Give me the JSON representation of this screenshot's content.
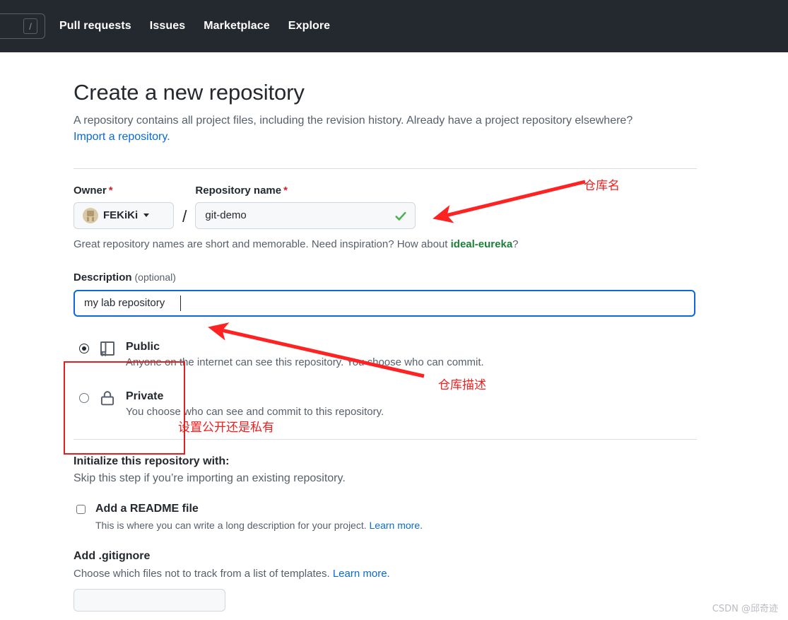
{
  "topnav": {
    "search_shortcut": "/",
    "links": [
      {
        "label": "Pull requests"
      },
      {
        "label": "Issues"
      },
      {
        "label": "Marketplace"
      },
      {
        "label": "Explore"
      }
    ]
  },
  "page": {
    "title": "Create a new repository",
    "subtitle": "A repository contains all project files, including the revision history. Already have a project repository elsewhere?",
    "import_link": "Import a repository."
  },
  "form": {
    "owner_label": "Owner",
    "owner_required": "*",
    "owner_value": "FEKiKi",
    "separator": "/",
    "repo_label": "Repository name",
    "repo_required": "*",
    "repo_value": "git-demo",
    "repo_placeholder": "",
    "name_hint_before": "Great repository names are short and memorable. Need inspiration? How about ",
    "name_hint_suggestion": "ideal-eureka",
    "name_hint_after": "?",
    "description_label": "Description",
    "description_optional": "(optional)",
    "description_value": "my lab repository",
    "description_placeholder": ""
  },
  "visibility": {
    "options": [
      {
        "title": "Public",
        "description": "Anyone on the internet can see this repository. You choose who can commit.",
        "icon": "book-icon",
        "selected": true
      },
      {
        "title": "Private",
        "description": "You choose who can see and commit to this repository.",
        "icon": "lock-icon",
        "selected": false
      }
    ]
  },
  "initialize": {
    "title": "Initialize this repository with:",
    "subtitle": "Skip this step if you’re importing an existing repository.",
    "readme_label": "Add a README file",
    "readme_desc": "This is where you can write a long description for your project.",
    "readme_learn_more": "Learn more.",
    "readme_checked": false,
    "gitignore_title": "Add .gitignore",
    "gitignore_desc": "Choose which files not to track from a list of templates.",
    "gitignore_learn_more": "Learn more."
  },
  "annotations": [
    {
      "text": "仓库名",
      "meaning": "repository-name"
    },
    {
      "text": "仓库描述",
      "meaning": "repository-description"
    },
    {
      "text": "设置公开还是私有",
      "meaning": "visibility-setting"
    }
  ],
  "watermark": "CSDN @邱奇迹",
  "colors": {
    "nav_bg": "#24292f",
    "accent_blue": "#0969da",
    "success_green": "#1a7f37",
    "required_red": "#cf222e",
    "annotation_red": "#e02020"
  }
}
